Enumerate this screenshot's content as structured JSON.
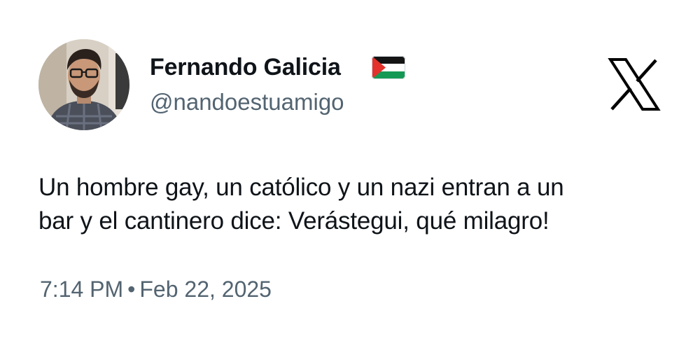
{
  "author": {
    "display_name": "Fernando Galicia",
    "handle": "@nandoestuamigo",
    "avatar_icon": "profile-photo-man-glasses",
    "badge_icon": "palestine-flag-emoji"
  },
  "brand": {
    "icon": "x-logo",
    "color": "#000000"
  },
  "tweet": {
    "text_line1": "Un hombre gay, un católico y un nazi entran a un",
    "text_line2": "bar y el cantinero dice: Verástegui, qué milagro!"
  },
  "meta": {
    "time": "7:14 PM",
    "separator": "•",
    "date": "Feb 22, 2025"
  },
  "colors": {
    "text": "#0f1419",
    "secondary": "#536471",
    "background": "#ffffff"
  }
}
